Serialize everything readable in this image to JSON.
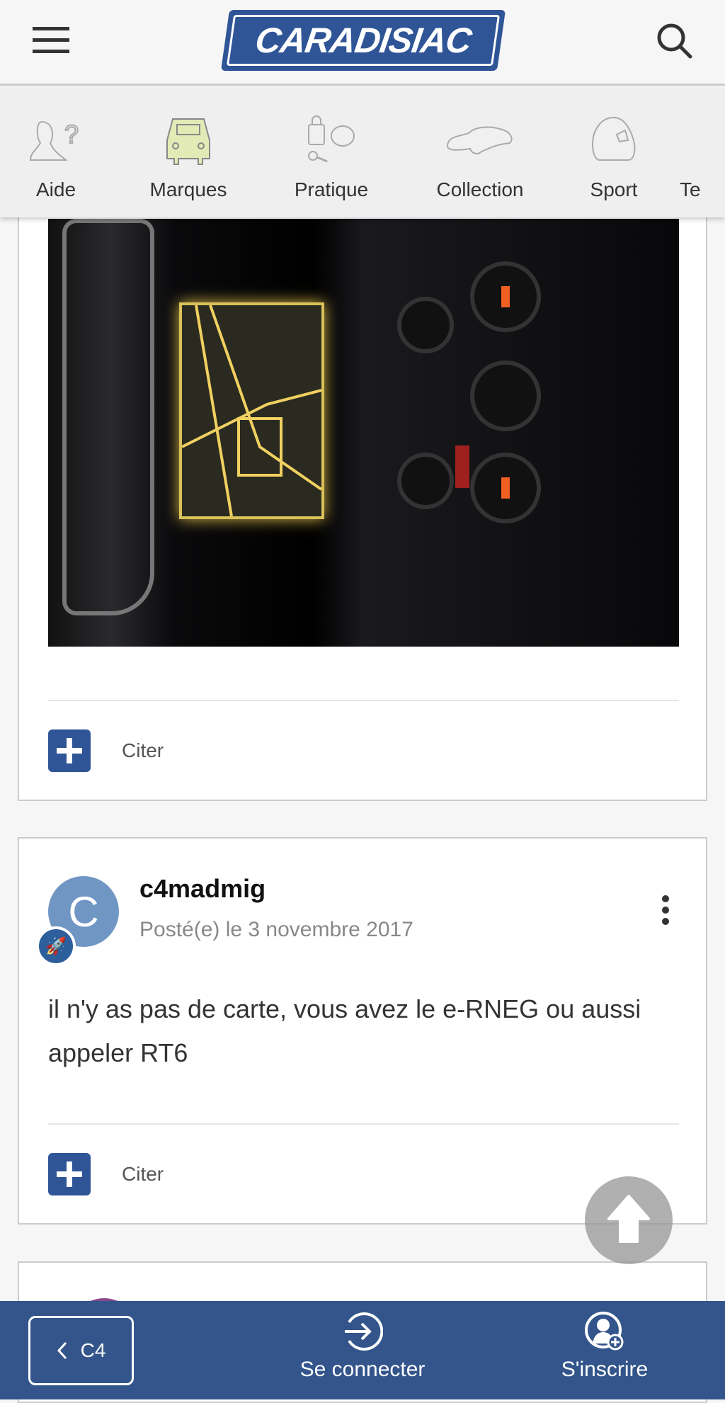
{
  "header": {
    "logo_text": "CARADISIAC",
    "menu_icon": "hamburger-icon",
    "search_icon": "search-icon"
  },
  "nav": {
    "items": [
      {
        "label": "Aide",
        "icon": "help-person-icon"
      },
      {
        "label": "Marques",
        "icon": "car-icon"
      },
      {
        "label": "Pratique",
        "icon": "lock-key-chat-icon"
      },
      {
        "label": "Collection",
        "icon": "classic-car-icon"
      },
      {
        "label": "Sport",
        "icon": "helmet-icon"
      },
      {
        "label": "Te"
      }
    ]
  },
  "posts": [
    {
      "quote_label": "Citer"
    },
    {
      "author": "c4madmig",
      "avatar_letter": "C",
      "date": "Posté(e) le 3 novembre 2017",
      "body": "il n'y as pas de carte, vous avez le e-RNEG ou aussi appeler RT6",
      "quote_label": "Citer"
    }
  ],
  "bottom": {
    "back_label": "C4",
    "login_label": "Se connecter",
    "register_label": "S'inscrire"
  },
  "colors": {
    "brand": "#2f5597",
    "bottom_bar": "#33558b"
  }
}
